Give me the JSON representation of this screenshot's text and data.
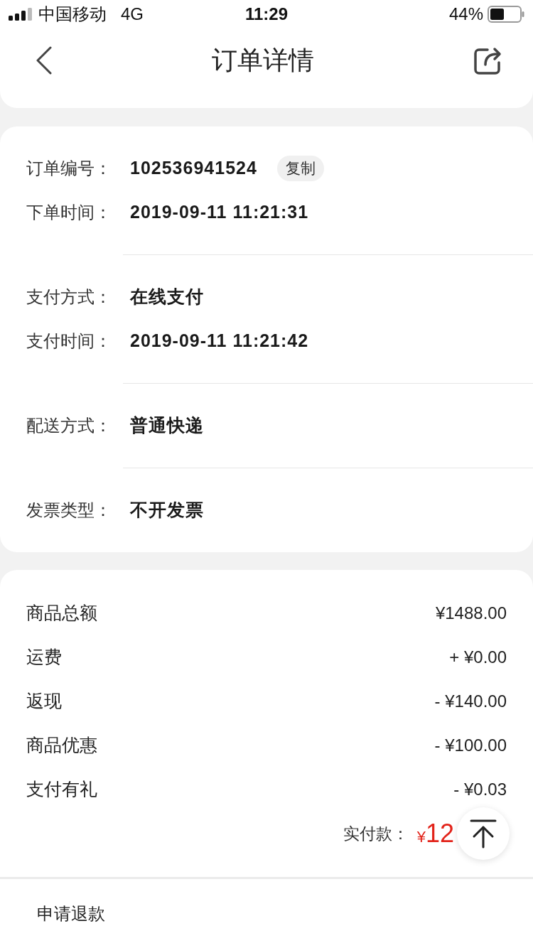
{
  "status_bar": {
    "carrier": "中国移动",
    "network": "4G",
    "time": "11:29",
    "battery": "44%"
  },
  "nav": {
    "title": "订单详情"
  },
  "order_info": {
    "groups": [
      {
        "rows": [
          {
            "label": "订单编号：",
            "value": "102536941524",
            "action": "复制"
          },
          {
            "label": "下单时间：",
            "value": "2019-09-11 11:21:31"
          }
        ]
      },
      {
        "rows": [
          {
            "label": "支付方式：",
            "value": "在线支付"
          },
          {
            "label": "支付时间：",
            "value": "2019-09-11 11:21:42"
          }
        ]
      },
      {
        "rows": [
          {
            "label": "配送方式：",
            "value": "普通快递"
          }
        ]
      },
      {
        "rows": [
          {
            "label": "发票类型：",
            "value": "不开发票"
          }
        ]
      }
    ]
  },
  "price_summary": {
    "rows": [
      {
        "label": "商品总额",
        "value": "¥1488.00"
      },
      {
        "label": "运费",
        "value": "+ ¥0.00"
      },
      {
        "label": "返现",
        "value": "- ¥140.00"
      },
      {
        "label": "商品优惠",
        "value": "- ¥100.00"
      },
      {
        "label": "支付有礼",
        "value": "- ¥0.03"
      }
    ],
    "total": {
      "label": "实付款：",
      "currency": "¥",
      "amount": "12"
    }
  },
  "bottom_bar": {
    "actions": [
      "申请退款"
    ]
  }
}
